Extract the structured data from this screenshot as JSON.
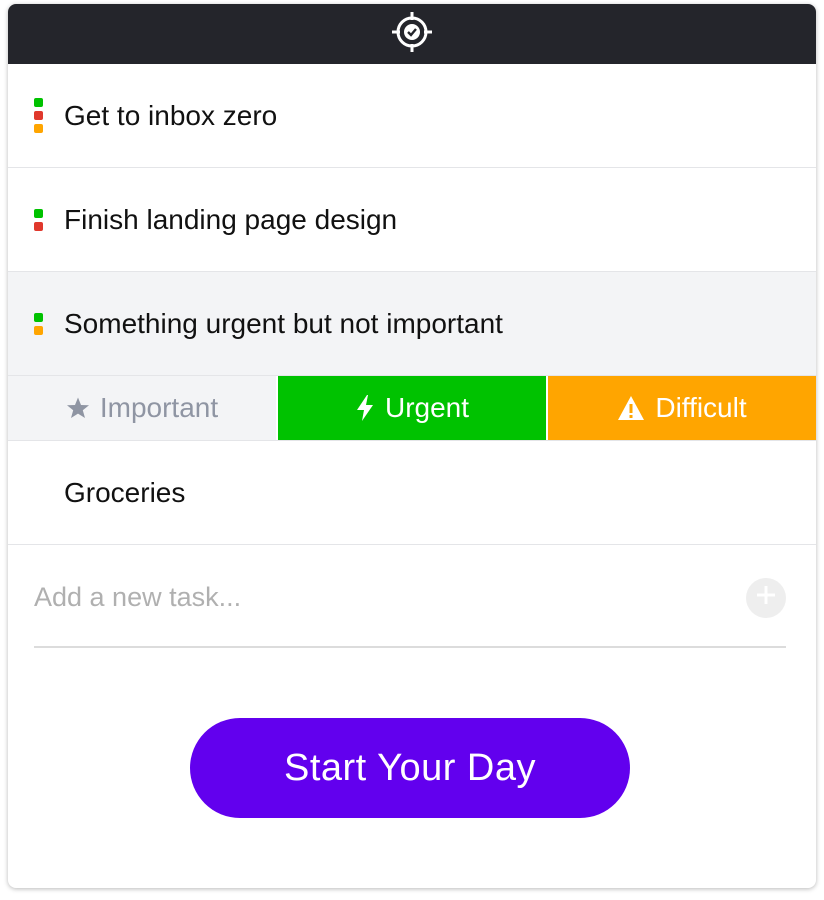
{
  "header": {
    "logo_icon": "target-check-icon"
  },
  "tasks": [
    {
      "label": "Get to inbox zero",
      "dots": [
        "#00c200",
        "#e0382c",
        "#ffa500"
      ]
    },
    {
      "label": "Finish landing page design",
      "dots": [
        "#00c200",
        "#e0382c"
      ]
    },
    {
      "label": "Something urgent but not important",
      "dots": [
        "#00c200",
        "#ffa500"
      ],
      "selected": true
    }
  ],
  "tag_bar": {
    "important": {
      "label": "Important",
      "icon": "star-icon",
      "active": false
    },
    "urgent": {
      "label": "Urgent",
      "icon": "lightning-bolt-icon",
      "color": "#00c200",
      "active": true
    },
    "difficult": {
      "label": "Difficult",
      "icon": "warning-icon",
      "color": "#ffa500",
      "active": true
    }
  },
  "task_after": {
    "label": "Groceries"
  },
  "new_task": {
    "placeholder": "Add a new task...",
    "value": "",
    "add_icon": "plus-icon"
  },
  "start_button": {
    "label": "Start Your Day",
    "color": "#6200ee"
  }
}
